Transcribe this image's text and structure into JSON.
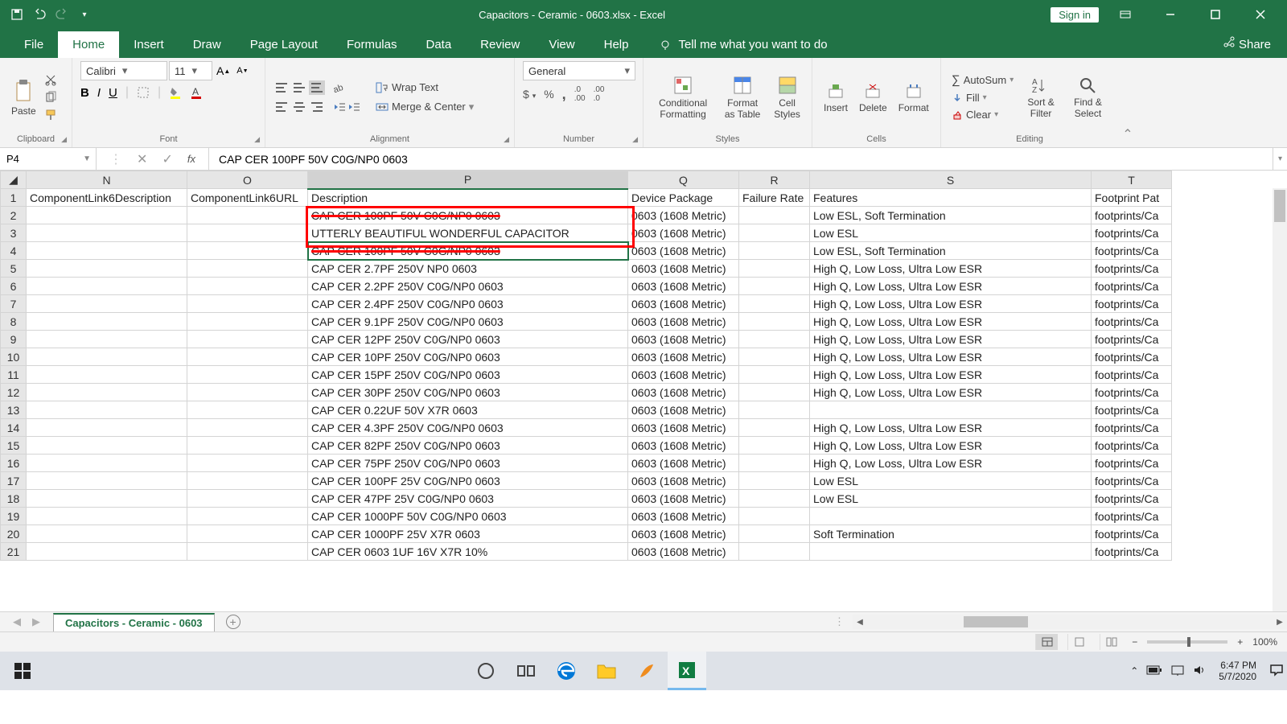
{
  "titlebar": {
    "title": "Capacitors - Ceramic - 0603.xlsx - Excel",
    "signin": "Sign in"
  },
  "tabs": {
    "items": [
      "File",
      "Home",
      "Insert",
      "Draw",
      "Page Layout",
      "Formulas",
      "Data",
      "Review",
      "View",
      "Help"
    ],
    "active": "Home",
    "tellme": "Tell me what you want to do",
    "share": "Share"
  },
  "ribbon": {
    "clipboard": {
      "paste": "Paste",
      "label": "Clipboard"
    },
    "font": {
      "name": "Calibri",
      "size": "11",
      "label": "Font"
    },
    "alignment": {
      "wrap": "Wrap Text",
      "merge": "Merge & Center",
      "label": "Alignment"
    },
    "number": {
      "format": "General",
      "label": "Number"
    },
    "styles": {
      "cond": "Conditional Formatting",
      "table": "Format as Table",
      "cell": "Cell Styles",
      "label": "Styles"
    },
    "cells": {
      "insert": "Insert",
      "delete": "Delete",
      "format": "Format",
      "label": "Cells"
    },
    "editing": {
      "autosum": "AutoSum",
      "fill": "Fill",
      "clear": "Clear",
      "sort": "Sort & Filter",
      "find": "Find & Select",
      "label": "Editing"
    }
  },
  "formula_bar": {
    "cell_ref": "P4",
    "formula": "CAP CER 100PF 50V C0G/NP0 0603"
  },
  "grid": {
    "columns": [
      {
        "letter": "N",
        "header": "ComponentLink6Description"
      },
      {
        "letter": "O",
        "header": "ComponentLink6URL"
      },
      {
        "letter": "P",
        "header": "Description"
      },
      {
        "letter": "Q",
        "header": "Device Package"
      },
      {
        "letter": "R",
        "header": "Failure Rate"
      },
      {
        "letter": "S",
        "header": "Features"
      },
      {
        "letter": "T",
        "header": "Footprint Pat"
      }
    ],
    "rows": [
      {
        "n": 2,
        "P": "CAP CER 100PF 50V C0G/NP0 0603",
        "Q": "0603 (1608 Metric)",
        "R": "",
        "S": "Low ESL, Soft Termination",
        "T": "footprints/Ca"
      },
      {
        "n": 3,
        "P": "UTTERLY BEAUTIFUL WONDERFUL CAPACITOR",
        "Q": "0603 (1608 Metric)",
        "R": "",
        "S": "Low ESL",
        "T": "footprints/Ca"
      },
      {
        "n": 4,
        "P": "CAP CER 100PF 50V C0G/NP0 0603",
        "Q": "0603 (1608 Metric)",
        "R": "",
        "S": "Low ESL, Soft Termination",
        "T": "footprints/Ca"
      },
      {
        "n": 5,
        "P": "CAP CER 2.7PF 250V NP0 0603",
        "Q": "0603 (1608 Metric)",
        "R": "",
        "S": "High Q, Low Loss, Ultra Low ESR",
        "T": "footprints/Ca"
      },
      {
        "n": 6,
        "P": "CAP CER 2.2PF 250V C0G/NP0 0603",
        "Q": "0603 (1608 Metric)",
        "R": "",
        "S": "High Q, Low Loss, Ultra Low ESR",
        "T": "footprints/Ca"
      },
      {
        "n": 7,
        "P": "CAP CER 2.4PF 250V C0G/NP0 0603",
        "Q": "0603 (1608 Metric)",
        "R": "",
        "S": "High Q, Low Loss, Ultra Low ESR",
        "T": "footprints/Ca"
      },
      {
        "n": 8,
        "P": "CAP CER 9.1PF 250V C0G/NP0 0603",
        "Q": "0603 (1608 Metric)",
        "R": "",
        "S": "High Q, Low Loss, Ultra Low ESR",
        "T": "footprints/Ca"
      },
      {
        "n": 9,
        "P": "CAP CER 12PF 250V C0G/NP0 0603",
        "Q": "0603 (1608 Metric)",
        "R": "",
        "S": "High Q, Low Loss, Ultra Low ESR",
        "T": "footprints/Ca"
      },
      {
        "n": 10,
        "P": "CAP CER 10PF 250V C0G/NP0 0603",
        "Q": "0603 (1608 Metric)",
        "R": "",
        "S": "High Q, Low Loss, Ultra Low ESR",
        "T": "footprints/Ca"
      },
      {
        "n": 11,
        "P": "CAP CER 15PF 250V C0G/NP0 0603",
        "Q": "0603 (1608 Metric)",
        "R": "",
        "S": "High Q, Low Loss, Ultra Low ESR",
        "T": "footprints/Ca"
      },
      {
        "n": 12,
        "P": "CAP CER 30PF 250V C0G/NP0 0603",
        "Q": "0603 (1608 Metric)",
        "R": "",
        "S": "High Q, Low Loss, Ultra Low ESR",
        "T": "footprints/Ca"
      },
      {
        "n": 13,
        "P": "CAP CER 0.22UF 50V X7R 0603",
        "Q": "0603 (1608 Metric)",
        "R": "",
        "S": "",
        "T": "footprints/Ca"
      },
      {
        "n": 14,
        "P": "CAP CER 4.3PF 250V C0G/NP0 0603",
        "Q": "0603 (1608 Metric)",
        "R": "",
        "S": "High Q, Low Loss, Ultra Low ESR",
        "T": "footprints/Ca"
      },
      {
        "n": 15,
        "P": "CAP CER 82PF 250V C0G/NP0 0603",
        "Q": "0603 (1608 Metric)",
        "R": "",
        "S": "High Q, Low Loss, Ultra Low ESR",
        "T": "footprints/Ca"
      },
      {
        "n": 16,
        "P": "CAP CER 75PF 250V C0G/NP0 0603",
        "Q": "0603 (1608 Metric)",
        "R": "",
        "S": "High Q, Low Loss, Ultra Low ESR",
        "T": "footprints/Ca"
      },
      {
        "n": 17,
        "P": "CAP CER 100PF 25V C0G/NP0 0603",
        "Q": "0603 (1608 Metric)",
        "R": "",
        "S": "Low ESL",
        "T": "footprints/Ca"
      },
      {
        "n": 18,
        "P": "CAP CER 47PF 25V C0G/NP0 0603",
        "Q": "0603 (1608 Metric)",
        "R": "",
        "S": "Low ESL",
        "T": "footprints/Ca"
      },
      {
        "n": 19,
        "P": "CAP CER 1000PF 50V C0G/NP0 0603",
        "Q": "0603 (1608 Metric)",
        "R": "",
        "S": "",
        "T": "footprints/Ca"
      },
      {
        "n": 20,
        "P": "CAP CER 1000PF 25V X7R 0603",
        "Q": "0603 (1608 Metric)",
        "R": "",
        "S": "Soft Termination",
        "T": "footprints/Ca"
      },
      {
        "n": 21,
        "P": "CAP CER 0603 1UF 16V X7R 10%",
        "Q": "0603 (1608 Metric)",
        "R": "",
        "S": "",
        "T": "footprints/Ca"
      }
    ],
    "selected_cell": "P4"
  },
  "sheet": {
    "active_tab": "Capacitors - Ceramic - 0603"
  },
  "statusbar": {
    "zoom": "100%"
  },
  "taskbar": {
    "time": "6:47 PM",
    "date": "5/7/2020"
  }
}
